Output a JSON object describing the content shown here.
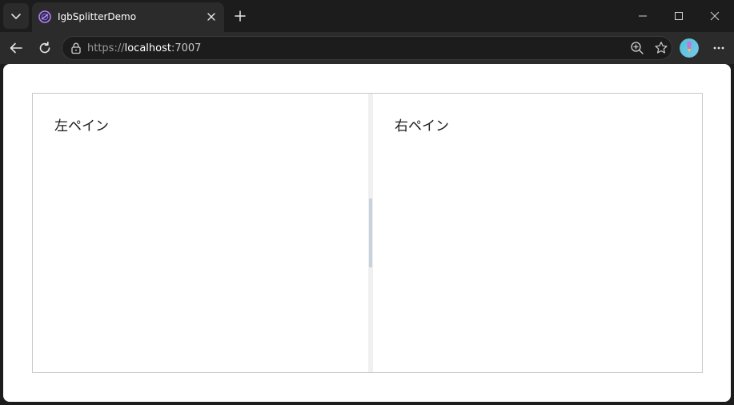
{
  "browser": {
    "tab": {
      "title": "IgbSplitterDemo"
    },
    "address": {
      "scheme": "https://",
      "host": "localhost",
      "port": ":7007"
    }
  },
  "page": {
    "left_pane_label": "左ペイン",
    "right_pane_label": "右ペイン"
  },
  "icons": {
    "tab_list": "chevron-down-icon",
    "favicon": "blazor-icon",
    "tab_close": "close-icon",
    "new_tab": "plus-icon",
    "minimize": "minimize-icon",
    "maximize": "maximize-icon",
    "close_window": "close-icon",
    "back": "arrow-left-icon",
    "reload": "refresh-icon",
    "lock": "lock-icon",
    "zoom": "zoom-in-icon",
    "favorite": "star-icon",
    "profile": "avatar-icon",
    "more": "more-icon"
  },
  "colors": {
    "chrome_dark": "#1c1c1c",
    "toolbar": "#2b2b2b",
    "page_bg": "#ffffff",
    "splitter_border": "#c9c9c9",
    "splitter_bar": "#f0f0f0",
    "splitter_handle": "#c9d1dd"
  }
}
